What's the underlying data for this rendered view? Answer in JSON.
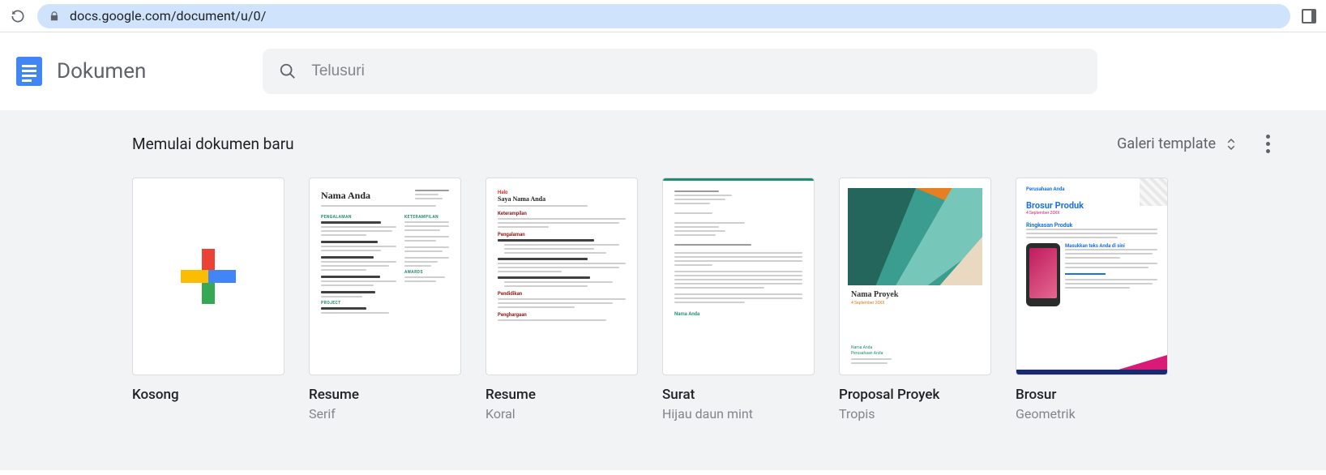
{
  "browser": {
    "url": "docs.google.com/document/u/0/"
  },
  "header": {
    "app_title": "Dokumen",
    "search_placeholder": "Telusuri"
  },
  "gallery": {
    "title": "Memulai dokumen baru",
    "link_label": "Galeri template",
    "templates": [
      {
        "title": "Kosong",
        "subtitle": ""
      },
      {
        "title": "Resume",
        "subtitle": "Serif"
      },
      {
        "title": "Resume",
        "subtitle": "Koral"
      },
      {
        "title": "Surat",
        "subtitle": "Hijau daun mint"
      },
      {
        "title": "Proposal Proyek",
        "subtitle": "Tropis"
      },
      {
        "title": "Brosur",
        "subtitle": "Geometrik"
      }
    ]
  },
  "thumbs": {
    "serif": {
      "name": "Nama Anda",
      "sec_exp": "PENGALAMAN",
      "sec_skill": "KETERAMPILAN",
      "sec_proj": "PROJECT"
    },
    "koral": {
      "hello": "Halo",
      "name": "Saya Nama Anda",
      "skill": "Keterampilan",
      "exp": "Pengalaman",
      "edu": "Pendidikan",
      "award": "Penghargaan"
    },
    "surat": {
      "signature": "Nama Anda"
    },
    "proposal": {
      "title": "Nama Proyek",
      "date": "4 September 20XX",
      "footer_name": "Nama Anda",
      "footer_co": "Perusahaan Anda"
    },
    "brosur": {
      "company": "Perusahaan Anda",
      "h1": "Brosur Produk",
      "date": "4 September 20XX",
      "h2": "Ringkasan Produk",
      "h3": "Masukkan teks Anda di sini"
    }
  }
}
